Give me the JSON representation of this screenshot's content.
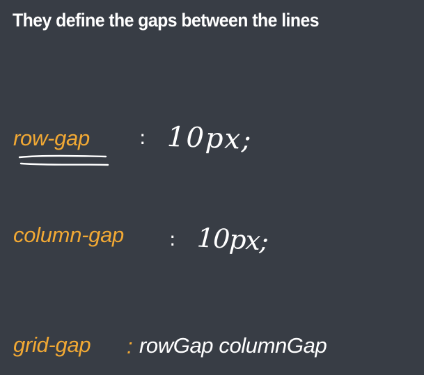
{
  "slide": {
    "title": "They define the gaps between the lines",
    "background": "#383d45",
    "accent": "#f2a934",
    "rows": [
      {
        "property": "row-gap",
        "separator": ":",
        "handwritten_value": "10px;"
      },
      {
        "property": "column-gap",
        "separator": ":",
        "handwritten_value": "10px;"
      },
      {
        "property": "grid-gap",
        "separator": ":",
        "value": "rowGap columnGap"
      }
    ],
    "annotations": {
      "row_gap_underline": "double-stroke",
      "ink_color": "#ffffff"
    }
  }
}
